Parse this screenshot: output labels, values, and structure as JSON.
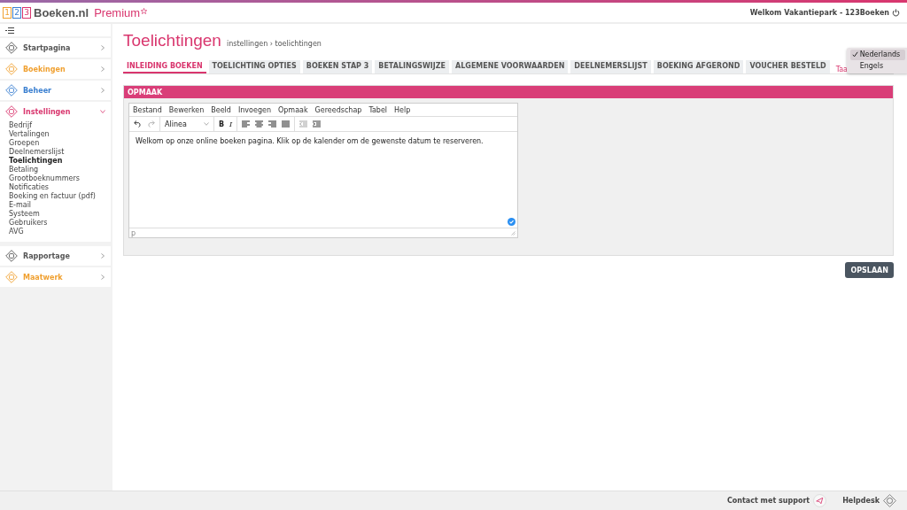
{
  "logo": {
    "digits": [
      "1",
      "2",
      "3"
    ],
    "name": "Boeken.nl",
    "edition": "Premium"
  },
  "header": {
    "welcome": "Welkom Vakantiepark - 123Boeken"
  },
  "sidebar": {
    "items": [
      {
        "label": "Startpagina",
        "color": "#555555",
        "expanded": false
      },
      {
        "label": "Boekingen",
        "color": "#f0a030",
        "expanded": false
      },
      {
        "label": "Beheer",
        "color": "#3a7fd0",
        "expanded": false
      },
      {
        "label": "Instellingen",
        "color": "#d9366e",
        "expanded": true,
        "children": [
          {
            "label": "Bedrijf",
            "selected": false
          },
          {
            "label": "Vertalingen",
            "selected": false
          },
          {
            "label": "Groepen",
            "selected": false
          },
          {
            "label": "Deelnemerslijst",
            "selected": false
          },
          {
            "label": "Toelichtingen",
            "selected": true
          },
          {
            "label": "Betaling",
            "selected": false
          },
          {
            "label": "Grootboeknummers",
            "selected": false
          },
          {
            "label": "Notificaties",
            "selected": false
          },
          {
            "label": "Boeking en factuur (pdf)",
            "selected": false
          },
          {
            "label": "E-mail",
            "selected": false
          },
          {
            "label": "Systeem",
            "selected": false
          },
          {
            "label": "Gebruikers",
            "selected": false
          },
          {
            "label": "AVG",
            "selected": false
          }
        ]
      },
      {
        "label": "Rapportage",
        "color": "#555555",
        "expanded": false
      },
      {
        "label": "Maatwerk",
        "color": "#f0a030",
        "expanded": false
      }
    ]
  },
  "page": {
    "title": "Toelichtingen",
    "breadcrumb": "instellingen › toelichtingen"
  },
  "tabs": [
    {
      "label": "INLEIDING BOEKEN",
      "selected": true
    },
    {
      "label": "TOELICHTING OPTIES",
      "selected": false
    },
    {
      "label": "BOEKEN STAP 3",
      "selected": false
    },
    {
      "label": "BETALINGSWIJZE",
      "selected": false
    },
    {
      "label": "ALGEMENE VOORWAARDEN",
      "selected": false
    },
    {
      "label": "DEELNEMERSLIJST",
      "selected": false
    },
    {
      "label": "BOEKING AFGEROND",
      "selected": false
    },
    {
      "label": "VOUCHER BESTELD",
      "selected": false
    }
  ],
  "language": {
    "label": "Taa",
    "options": [
      {
        "label": "Nederlands",
        "selected": true
      },
      {
        "label": "Engels",
        "selected": false
      }
    ]
  },
  "panel": {
    "title": "OPMAAK"
  },
  "editor": {
    "menu": [
      "Bestand",
      "Bewerken",
      "Beeld",
      "Invoegen",
      "Opmaak",
      "Gereedschap",
      "Tabel",
      "Help"
    ],
    "format": "Alinea",
    "bold": "B",
    "italic": "I",
    "content": "Welkom op onze online boeken pagina. Klik op de kalender om de gewenste datum te reserveren.",
    "path": "p"
  },
  "save_button": "OPSLAAN",
  "footer": {
    "support": "Contact met support",
    "helpdesk": "Helpdesk"
  }
}
